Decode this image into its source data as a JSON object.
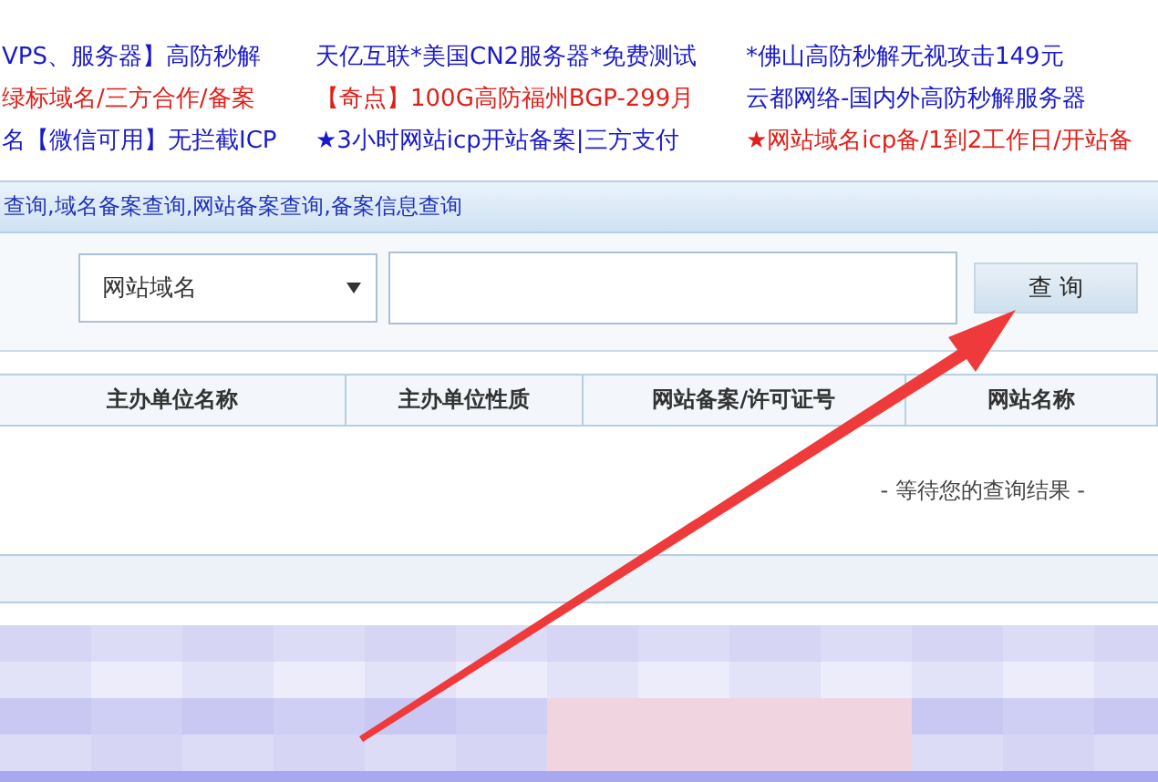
{
  "ads": [
    {
      "text": "VPS、服务器】高防秒解",
      "color": "#1a1acc"
    },
    {
      "text": "天亿互联*美国CN2服务器*免费测试",
      "color": "#1a1acc"
    },
    {
      "text": "*佛山高防秒解无视攻击149元",
      "color": "#1a1acc"
    },
    {
      "text": "绿标域名/三方合作/备案",
      "color": "#e0201a"
    },
    {
      "text": "【奇点】100G高防福州BGP-299月",
      "color": "#e0201a"
    },
    {
      "text": "云都网络-国内外高防秒解服务器",
      "color": "#1a1acc"
    },
    {
      "text": "名【微信可用】无拦截ICP",
      "color": "#1a1acc"
    },
    {
      "text": "★3小时网站icp开站备案|三方支付",
      "color": "#1a1acc"
    },
    {
      "text": "★网站域名icp备/1到2工作日/开站备",
      "color": "#e0201a"
    }
  ],
  "header": {
    "title": "查询,域名备案查询,网站备案查询,备案信息查询"
  },
  "search": {
    "type_select": "网站域名",
    "button": "查 询"
  },
  "table": {
    "columns": [
      "主办单位名称",
      "主办单位性质",
      "网站备案/许可证号",
      "网站名称"
    ],
    "empty_message": "- 等待您的查询结果 -"
  }
}
